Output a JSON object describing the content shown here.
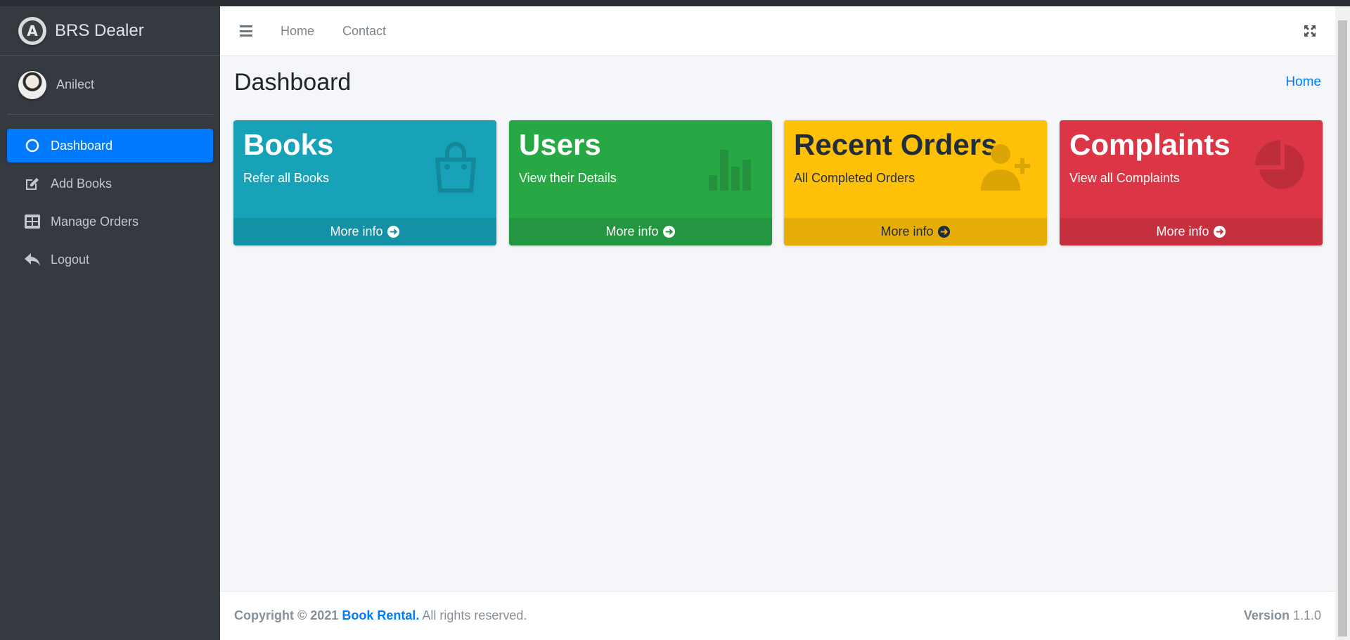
{
  "brand": {
    "title": "BRS Dealer",
    "logo_letter": "A"
  },
  "user": {
    "name": "Anilect"
  },
  "sidebar": {
    "items": [
      {
        "label": "Dashboard",
        "icon": "circle-icon",
        "active": true
      },
      {
        "label": "Add Books",
        "icon": "edit-icon"
      },
      {
        "label": "Manage Orders",
        "icon": "table-icon"
      },
      {
        "label": "Logout",
        "icon": "reply-icon"
      }
    ]
  },
  "navbar": {
    "links": [
      "Home",
      "Contact"
    ]
  },
  "page": {
    "title": "Dashboard",
    "breadcrumb": "Home"
  },
  "boxes": [
    {
      "title": "Books",
      "subtitle": "Refer all Books",
      "more": "More info",
      "icon": "bag-icon",
      "color": "#17a2b8"
    },
    {
      "title": "Users",
      "subtitle": "View their Details",
      "more": "More info",
      "icon": "bar-chart-icon",
      "color": "#28a745"
    },
    {
      "title": "Recent Orders",
      "subtitle": "All Completed Orders",
      "more": "More info",
      "icon": "user-plus-icon",
      "color": "#ffc107"
    },
    {
      "title": "Complaints",
      "subtitle": "View all Complaints",
      "more": "More info",
      "icon": "pie-chart-icon",
      "color": "#dc3545"
    }
  ],
  "footer": {
    "copyright": "Copyright © 2021",
    "company": "Book Rental.",
    "rights": "All rights reserved.",
    "version_label": "Version",
    "version": "1.1.0"
  }
}
